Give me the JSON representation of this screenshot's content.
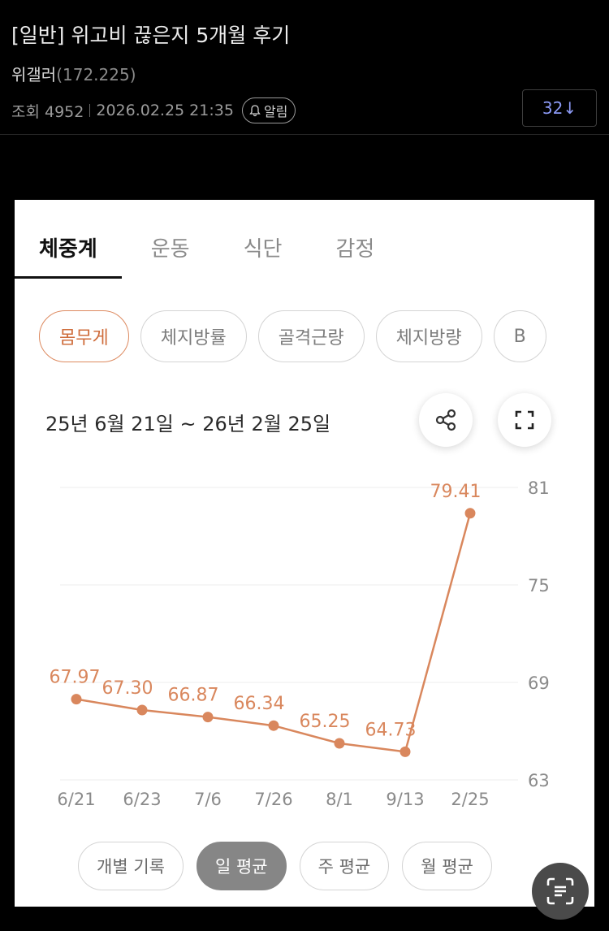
{
  "post": {
    "title": "[일반] 위고비 끊은지 5개월 후기",
    "author": "위갤러",
    "author_id": "(172.225)",
    "views_label": "조회 4952",
    "datetime": "2026.02.25 21:35",
    "alarm_label": "알림",
    "comment_count": "32↓"
  },
  "app": {
    "tabs": [
      "체중계",
      "운동",
      "식단",
      "감정"
    ],
    "metric_chips": [
      "몸무게",
      "체지방률",
      "골격근량",
      "체지방량",
      "B"
    ],
    "date_range": "25년 6월 21일 ~ 26년 2월 25일",
    "share_icon": "share-icon",
    "expand_icon": "fullscreen-icon",
    "view_buttons": [
      "개별 기록",
      "일 평균",
      "주 평균",
      "월 평균"
    ],
    "active_view": "일 평균",
    "accent_color": "#d9875d"
  },
  "chart_data": {
    "type": "line",
    "x": [
      "6/21",
      "6/23",
      "7/6",
      "7/26",
      "8/1",
      "9/13",
      "2/25"
    ],
    "values": [
      67.97,
      67.3,
      66.87,
      66.34,
      65.25,
      64.73,
      79.41
    ],
    "labels": [
      "67.97",
      "67.30",
      "66.87",
      "66.34",
      "65.25",
      "64.73",
      "79.41"
    ],
    "y_ticks": [
      "81",
      "75",
      "69",
      "63"
    ],
    "ylim": [
      63,
      81
    ],
    "y_axis_position": "right",
    "grid": true
  }
}
